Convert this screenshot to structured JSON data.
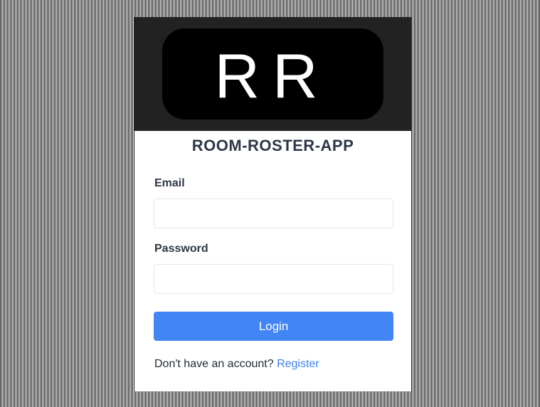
{
  "logo": {
    "text": "RR"
  },
  "app": {
    "title": "ROOM-ROSTER-APP"
  },
  "form": {
    "email_label": "Email",
    "email_value": "",
    "password_label": "Password",
    "password_value": "",
    "login_label": "Login"
  },
  "footer": {
    "prompt": "Don't have an account?",
    "register_label": "Register"
  },
  "colors": {
    "primary": "#4285f4",
    "link": "#3b82f6",
    "logo_band": "#222222",
    "logo_box": "#000000",
    "heading": "#2d3748"
  }
}
